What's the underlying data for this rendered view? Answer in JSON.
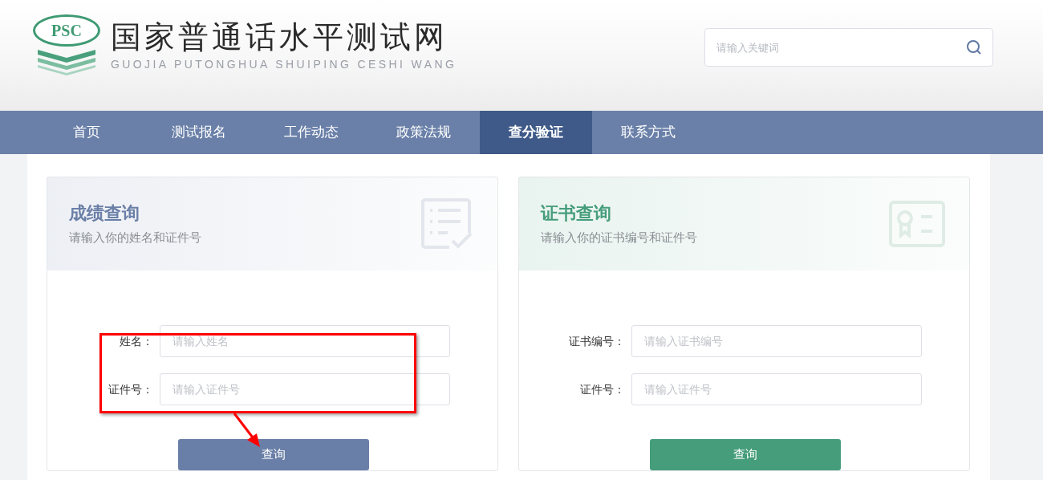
{
  "logo": {
    "badge": "PSC",
    "title": "国家普通话水平测试网",
    "subtitle": "GUOJIA PUTONGHUA SHUIPING CESHI WANG"
  },
  "search": {
    "placeholder": "请输入关键词"
  },
  "nav": [
    {
      "label": "首页",
      "selected": false
    },
    {
      "label": "测试报名",
      "selected": false
    },
    {
      "label": "工作动态",
      "selected": false
    },
    {
      "label": "政策法规",
      "selected": false
    },
    {
      "label": "查分验证",
      "selected": true
    },
    {
      "label": "联系方式",
      "selected": false
    }
  ],
  "cards": [
    {
      "kind": "score",
      "title": "成绩查询",
      "subtitle": "请输入你的姓名和证件号",
      "color": "#6a7fa7",
      "fields": [
        {
          "label": "姓名：",
          "placeholder": "请输入姓名"
        },
        {
          "label": "证件号：",
          "placeholder": "请输入证件号"
        }
      ],
      "button": "查询"
    },
    {
      "kind": "certificate",
      "title": "证书查询",
      "subtitle": "请输入你的证书编号和证件号",
      "color": "#469d7b",
      "fields": [
        {
          "label": "证书编号：",
          "placeholder": "请输入证书编号"
        },
        {
          "label": "证件号：",
          "placeholder": "请输入证件号"
        }
      ],
      "button": "查询"
    }
  ]
}
